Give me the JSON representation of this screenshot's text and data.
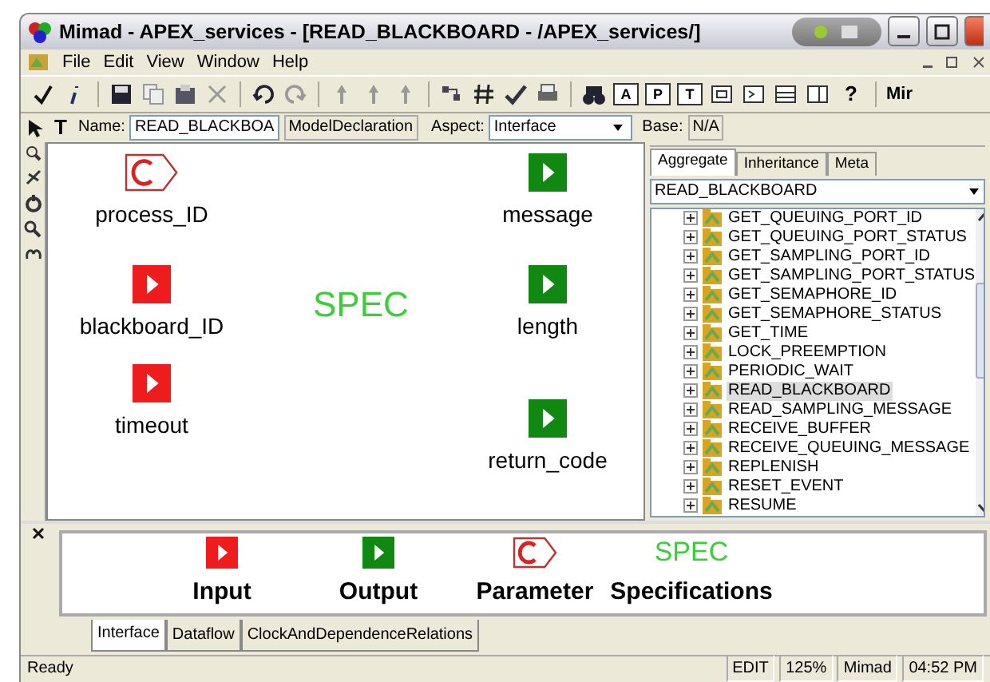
{
  "window": {
    "title": "Mimad - APEX_services - [READ_BLACKBOARD - /APEX_services/]"
  },
  "menu": [
    "File",
    "Edit",
    "View",
    "Window",
    "Help"
  ],
  "toolbar": {
    "view_buttons": [
      "A",
      "P",
      "T"
    ],
    "help": "?",
    "label": "Mir"
  },
  "name_bar": {
    "text_tool": "T",
    "name_label": "Name:",
    "name_value": "READ_BLACKBOA",
    "type": "ModelDeclaration",
    "aspect_label": "Aspect:",
    "aspect_value": "Interface",
    "base_label": "Base:",
    "base_value": "N/A"
  },
  "diagram": {
    "spec": "SPEC",
    "nodes": [
      {
        "kind": "parameter",
        "label": "process_ID"
      },
      {
        "kind": "input",
        "label": "blackboard_ID"
      },
      {
        "kind": "input",
        "label": "timeout"
      },
      {
        "kind": "output",
        "label": "message"
      },
      {
        "kind": "output",
        "label": "length"
      },
      {
        "kind": "output",
        "label": "return_code"
      }
    ]
  },
  "browser": {
    "tabs": [
      {
        "label": "Aggregate",
        "selected": true
      },
      {
        "label": "Inheritance",
        "selected": false
      },
      {
        "label": "Meta",
        "selected": false
      }
    ],
    "combo": "READ_BLACKBOARD",
    "items": [
      {
        "label": "GET_QUEUING_PORT_ID",
        "selected": false
      },
      {
        "label": "GET_QUEUING_PORT_STATUS",
        "selected": false
      },
      {
        "label": "GET_SAMPLING_PORT_ID",
        "selected": false
      },
      {
        "label": "GET_SAMPLING_PORT_STATUS",
        "selected": false
      },
      {
        "label": "GET_SEMAPHORE_ID",
        "selected": false
      },
      {
        "label": "GET_SEMAPHORE_STATUS",
        "selected": false
      },
      {
        "label": "GET_TIME",
        "selected": false
      },
      {
        "label": "LOCK_PREEMPTION",
        "selected": false
      },
      {
        "label": "PERIODIC_WAIT",
        "selected": false
      },
      {
        "label": "READ_BLACKBOARD",
        "selected": true
      },
      {
        "label": "READ_SAMPLING_MESSAGE",
        "selected": false
      },
      {
        "label": "RECEIVE_BUFFER",
        "selected": false
      },
      {
        "label": "RECEIVE_QUEUING_MESSAGE",
        "selected": false
      },
      {
        "label": "REPLENISH",
        "selected": false
      },
      {
        "label": "RESET_EVENT",
        "selected": false
      },
      {
        "label": "RESUME",
        "selected": false
      }
    ]
  },
  "parts": [
    {
      "kind": "input",
      "label": "Input"
    },
    {
      "kind": "output",
      "label": "Output"
    },
    {
      "kind": "parameter",
      "label": "Parameter"
    },
    {
      "kind": "spec",
      "label": "Specifications",
      "text": "SPEC"
    }
  ],
  "aspect_tabs": [
    {
      "label": "Interface",
      "selected": true
    },
    {
      "label": "Dataflow",
      "selected": false
    },
    {
      "label": "ClockAndDependenceRelations",
      "selected": false
    }
  ],
  "status_bar": {
    "message": "Ready",
    "panes": [
      "EDIT",
      "125%",
      "Mimad",
      "04:52 PM"
    ]
  }
}
